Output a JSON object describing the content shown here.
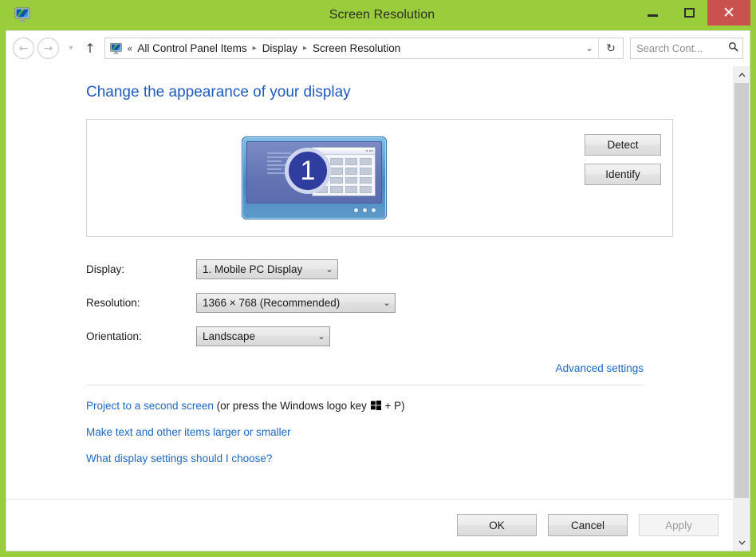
{
  "window": {
    "title": "Screen Resolution",
    "icon": "display-monitor-icon",
    "controls": {
      "minimize": "minimize-icon",
      "maximize": "maximize-icon",
      "close": "✕"
    },
    "titlebar_color": "#9ACD3C",
    "close_color": "#C9524F"
  },
  "navbar": {
    "back": "←",
    "forward": "→",
    "recent_locations": "▾",
    "up": "↑",
    "address_icon": "display-monitor-icon",
    "crumb_overflow": "«",
    "breadcrumbs": [
      "All Control Panel Items",
      "Display",
      "Screen Resolution"
    ],
    "separator": "▸",
    "dropdown": "⌄",
    "refresh": "↻",
    "search": {
      "placeholder": "Search Cont...",
      "value": "",
      "icon": "search-magnifier-icon"
    }
  },
  "main": {
    "heading": "Change the appearance of your display",
    "preview": {
      "monitor_number": "1",
      "buttons": [
        {
          "label": "Detect",
          "enabled": true
        },
        {
          "label": "Identify",
          "enabled": true
        }
      ]
    },
    "form": [
      {
        "label": "Display:",
        "value": "1. Mobile PC Display",
        "arrow": "⌄",
        "name": "display"
      },
      {
        "label": "Resolution:",
        "value": "1366 × 768 (Recommended)",
        "arrow": "⌄",
        "name": "resolution"
      },
      {
        "label": "Orientation:",
        "value": "Landscape",
        "arrow": "⌄",
        "name": "orientation"
      }
    ],
    "advanced_settings": "Advanced settings",
    "links": {
      "project_prefix": "Project to a second screen",
      "project_mid": " (or press the Windows logo key ",
      "project_suffix": " + P)",
      "windows_logo": "windows-logo-icon",
      "make_text_larger": "Make text and other items larger or smaller",
      "what_settings": "What display settings should I choose?"
    },
    "link_color": "#1D68C4"
  },
  "footer": {
    "buttons": [
      {
        "label": "OK",
        "enabled": true
      },
      {
        "label": "Cancel",
        "enabled": true
      },
      {
        "label": "Apply",
        "enabled": false
      }
    ]
  },
  "scrollbar": {
    "up": "⌃",
    "down": "⌄"
  }
}
